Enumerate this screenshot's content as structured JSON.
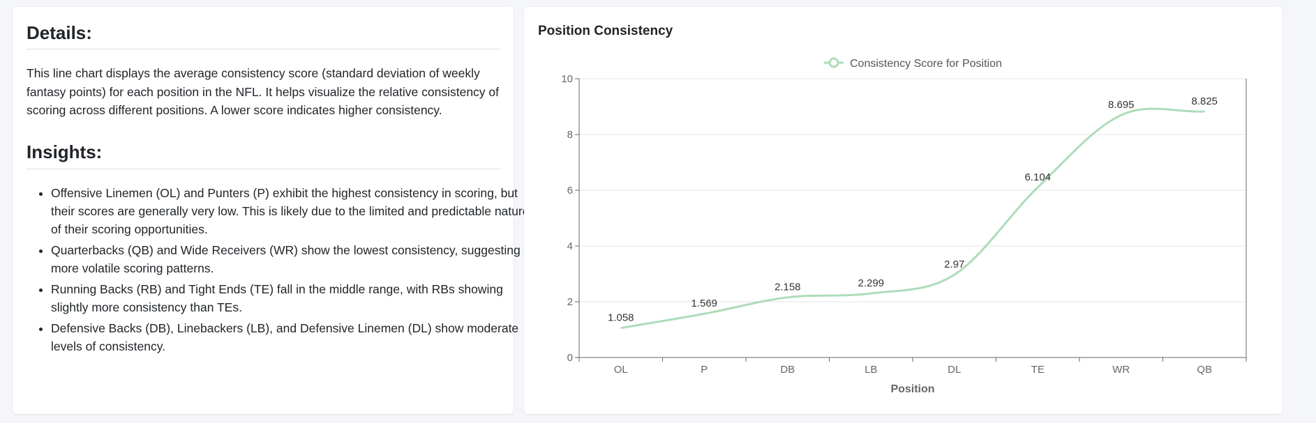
{
  "details": {
    "heading": "Details:",
    "text": "This line chart displays the average consistency score (standard deviation of weekly fantasy points) for each position in the NFL. It helps visualize the relative consistency of scoring across different positions. A lower score indicates higher consistency."
  },
  "insights": {
    "heading": "Insights:",
    "items": [
      "Offensive Linemen (OL) and Punters (P) exhibit the highest consistency in scoring, but their scores are generally very low. This is likely due to the limited and predictable nature of their scoring opportunities.",
      "Quarterbacks (QB) and Wide Receivers (WR) show the lowest consistency, suggesting more volatile scoring patterns.",
      "Running Backs (RB) and Tight Ends (TE) fall in the middle range, with RBs showing slightly more consistency than TEs.",
      "Defensive Backs (DB), Linebackers (LB), and Defensive Linemen (DL) show moderate levels of consistency."
    ]
  },
  "chart_card": {
    "title": "Position Consistency"
  },
  "chart_data": {
    "type": "line",
    "categories": [
      "OL",
      "P",
      "DB",
      "LB",
      "DL",
      "TE",
      "WR",
      "QB"
    ],
    "series": [
      {
        "name": "Consistency Score for Position",
        "values": [
          1.058,
          1.569,
          2.158,
          2.299,
          2.97,
          6.104,
          8.695,
          8.825
        ]
      }
    ],
    "data_labels": [
      "1.058",
      "1.569",
      "2.158",
      "2.299",
      "2.97",
      "6.104",
      "8.695",
      "8.825"
    ],
    "xlabel": "Position",
    "ylabel": "",
    "ylim": [
      0,
      10
    ],
    "yticks": [
      0,
      2,
      4,
      6,
      8,
      10
    ],
    "grid": true,
    "legend_position": "top",
    "line_color": "#aedcb9"
  }
}
